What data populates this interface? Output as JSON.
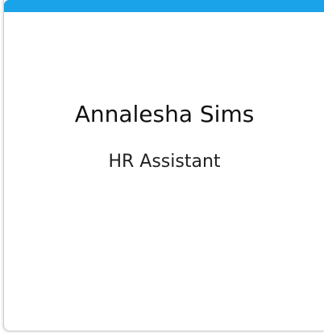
{
  "card": {
    "name": "Annalesha Sims",
    "title": "HR Assistant",
    "accent_color": "#1aa3e8"
  }
}
